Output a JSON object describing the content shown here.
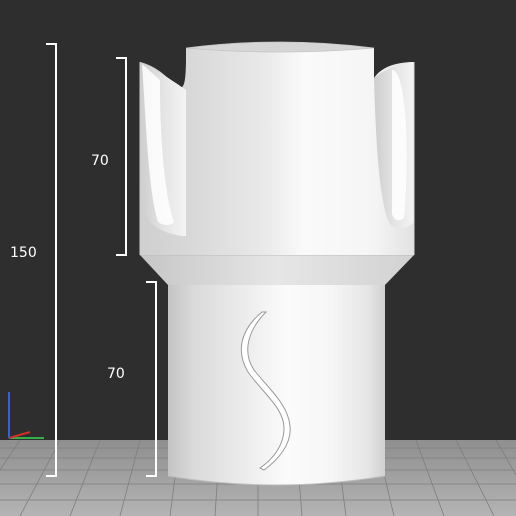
{
  "dimensions": {
    "total": "150",
    "upper": "70",
    "lower": "70"
  },
  "colors": {
    "background": "#2e2e2e",
    "floor": "#a8a8a8",
    "floor_grid": "#8c8c8c",
    "dimension_lines": "#ffffff",
    "model_light": "#f7f7f7",
    "model_mid": "#dcdcdc",
    "model_dark": "#b2b2b2",
    "axis_x": "#d0302a",
    "axis_y": "#35b048",
    "axis_z": "#3a5ed8"
  },
  "icons": [
    "axis-gizmo-icon"
  ]
}
